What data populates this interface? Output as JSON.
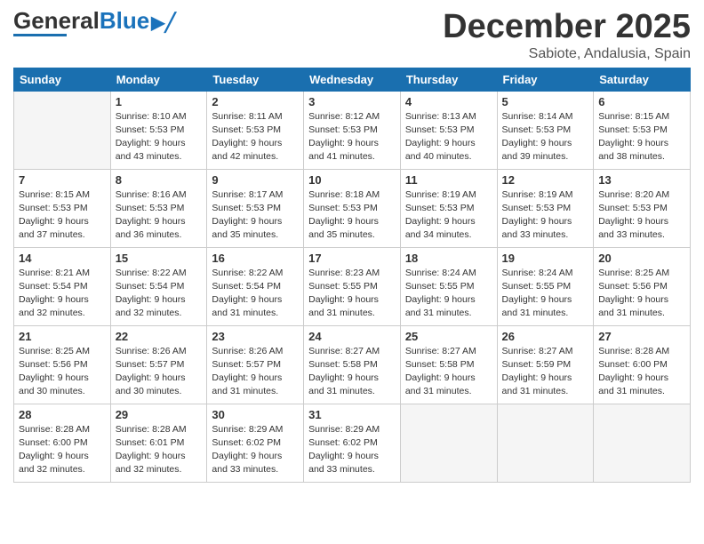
{
  "header": {
    "logo_general": "General",
    "logo_blue": "Blue",
    "month": "December 2025",
    "location": "Sabiote, Andalusia, Spain"
  },
  "weekdays": [
    "Sunday",
    "Monday",
    "Tuesday",
    "Wednesday",
    "Thursday",
    "Friday",
    "Saturday"
  ],
  "weeks": [
    [
      {
        "day": "",
        "info": ""
      },
      {
        "day": "1",
        "info": "Sunrise: 8:10 AM\nSunset: 5:53 PM\nDaylight: 9 hours\nand 43 minutes."
      },
      {
        "day": "2",
        "info": "Sunrise: 8:11 AM\nSunset: 5:53 PM\nDaylight: 9 hours\nand 42 minutes."
      },
      {
        "day": "3",
        "info": "Sunrise: 8:12 AM\nSunset: 5:53 PM\nDaylight: 9 hours\nand 41 minutes."
      },
      {
        "day": "4",
        "info": "Sunrise: 8:13 AM\nSunset: 5:53 PM\nDaylight: 9 hours\nand 40 minutes."
      },
      {
        "day": "5",
        "info": "Sunrise: 8:14 AM\nSunset: 5:53 PM\nDaylight: 9 hours\nand 39 minutes."
      },
      {
        "day": "6",
        "info": "Sunrise: 8:15 AM\nSunset: 5:53 PM\nDaylight: 9 hours\nand 38 minutes."
      }
    ],
    [
      {
        "day": "7",
        "info": "Sunrise: 8:15 AM\nSunset: 5:53 PM\nDaylight: 9 hours\nand 37 minutes."
      },
      {
        "day": "8",
        "info": "Sunrise: 8:16 AM\nSunset: 5:53 PM\nDaylight: 9 hours\nand 36 minutes."
      },
      {
        "day": "9",
        "info": "Sunrise: 8:17 AM\nSunset: 5:53 PM\nDaylight: 9 hours\nand 35 minutes."
      },
      {
        "day": "10",
        "info": "Sunrise: 8:18 AM\nSunset: 5:53 PM\nDaylight: 9 hours\nand 35 minutes."
      },
      {
        "day": "11",
        "info": "Sunrise: 8:19 AM\nSunset: 5:53 PM\nDaylight: 9 hours\nand 34 minutes."
      },
      {
        "day": "12",
        "info": "Sunrise: 8:19 AM\nSunset: 5:53 PM\nDaylight: 9 hours\nand 33 minutes."
      },
      {
        "day": "13",
        "info": "Sunrise: 8:20 AM\nSunset: 5:53 PM\nDaylight: 9 hours\nand 33 minutes."
      }
    ],
    [
      {
        "day": "14",
        "info": "Sunrise: 8:21 AM\nSunset: 5:54 PM\nDaylight: 9 hours\nand 32 minutes."
      },
      {
        "day": "15",
        "info": "Sunrise: 8:22 AM\nSunset: 5:54 PM\nDaylight: 9 hours\nand 32 minutes."
      },
      {
        "day": "16",
        "info": "Sunrise: 8:22 AM\nSunset: 5:54 PM\nDaylight: 9 hours\nand 31 minutes."
      },
      {
        "day": "17",
        "info": "Sunrise: 8:23 AM\nSunset: 5:55 PM\nDaylight: 9 hours\nand 31 minutes."
      },
      {
        "day": "18",
        "info": "Sunrise: 8:24 AM\nSunset: 5:55 PM\nDaylight: 9 hours\nand 31 minutes."
      },
      {
        "day": "19",
        "info": "Sunrise: 8:24 AM\nSunset: 5:55 PM\nDaylight: 9 hours\nand 31 minutes."
      },
      {
        "day": "20",
        "info": "Sunrise: 8:25 AM\nSunset: 5:56 PM\nDaylight: 9 hours\nand 31 minutes."
      }
    ],
    [
      {
        "day": "21",
        "info": "Sunrise: 8:25 AM\nSunset: 5:56 PM\nDaylight: 9 hours\nand 30 minutes."
      },
      {
        "day": "22",
        "info": "Sunrise: 8:26 AM\nSunset: 5:57 PM\nDaylight: 9 hours\nand 30 minutes."
      },
      {
        "day": "23",
        "info": "Sunrise: 8:26 AM\nSunset: 5:57 PM\nDaylight: 9 hours\nand 31 minutes."
      },
      {
        "day": "24",
        "info": "Sunrise: 8:27 AM\nSunset: 5:58 PM\nDaylight: 9 hours\nand 31 minutes."
      },
      {
        "day": "25",
        "info": "Sunrise: 8:27 AM\nSunset: 5:58 PM\nDaylight: 9 hours\nand 31 minutes."
      },
      {
        "day": "26",
        "info": "Sunrise: 8:27 AM\nSunset: 5:59 PM\nDaylight: 9 hours\nand 31 minutes."
      },
      {
        "day": "27",
        "info": "Sunrise: 8:28 AM\nSunset: 6:00 PM\nDaylight: 9 hours\nand 31 minutes."
      }
    ],
    [
      {
        "day": "28",
        "info": "Sunrise: 8:28 AM\nSunset: 6:00 PM\nDaylight: 9 hours\nand 32 minutes."
      },
      {
        "day": "29",
        "info": "Sunrise: 8:28 AM\nSunset: 6:01 PM\nDaylight: 9 hours\nand 32 minutes."
      },
      {
        "day": "30",
        "info": "Sunrise: 8:29 AM\nSunset: 6:02 PM\nDaylight: 9 hours\nand 33 minutes."
      },
      {
        "day": "31",
        "info": "Sunrise: 8:29 AM\nSunset: 6:02 PM\nDaylight: 9 hours\nand 33 minutes."
      },
      {
        "day": "",
        "info": ""
      },
      {
        "day": "",
        "info": ""
      },
      {
        "day": "",
        "info": ""
      }
    ]
  ]
}
